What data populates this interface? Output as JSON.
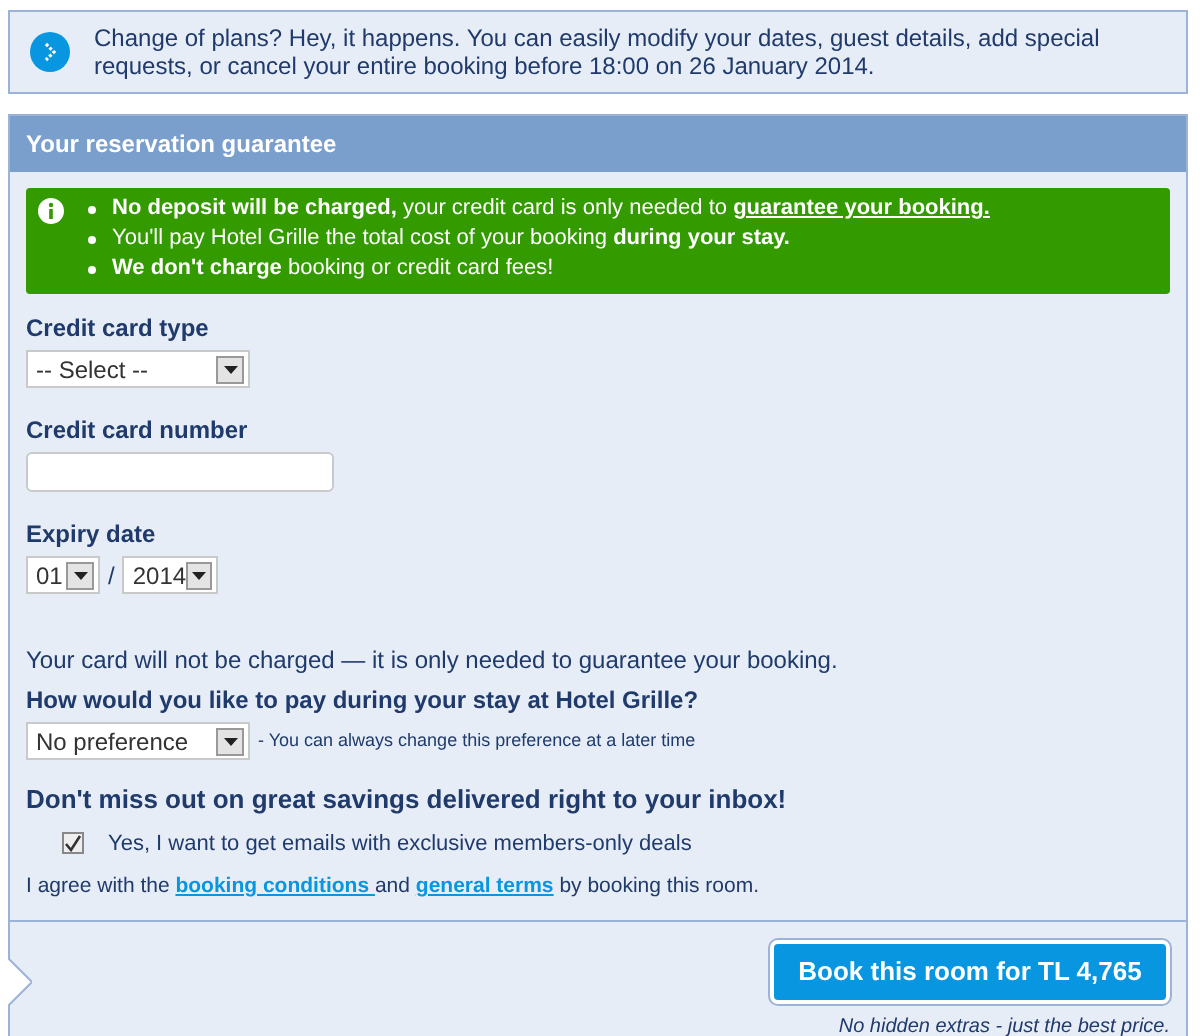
{
  "notice": {
    "text": "Change of plans? Hey, it happens. You can easily modify your dates, guest details, add special requests, or cancel your entire booking before 18:00 on 26 January 2014."
  },
  "guarantee": {
    "title": "Your reservation guarantee",
    "bullets": [
      [
        {
          "kind": "text",
          "text": "**No deposit will be charged,** your credit card is only needed to "
        },
        {
          "kind": "link",
          "text": "guarantee your booking."
        }
      ],
      [
        {
          "kind": "text",
          "text": "You'll pay Hotel Grille the total cost of your booking **during your stay.**"
        }
      ],
      [
        {
          "kind": "text",
          "text": "**We don't charge** booking or credit card fees!"
        }
      ]
    ]
  },
  "card_type": {
    "label": "Credit card type",
    "value": "-- Select --"
  },
  "card_number": {
    "label": "Credit card number"
  },
  "expiry": {
    "label": "Expiry date",
    "month": "01",
    "separator": "/",
    "year": "2014"
  },
  "not_charged": "Your card will not be charged — it is only needed to guarantee your booking.",
  "pay_question": "How would you like to pay during your stay at Hotel Grille?",
  "pay_select": {
    "value": "No preference",
    "hint": "- You can always change this preference at a later time"
  },
  "newsletter": {
    "title": "Don't miss out on great savings delivered right to your inbox!",
    "label": "Yes, I want to get emails with exclusive members-only deals",
    "checked": true
  },
  "agreement": [
    {
      "kind": "text",
      "text": "I agree with the "
    },
    {
      "kind": "link",
      "text": "booking conditions "
    },
    {
      "kind": "text",
      "text": "and "
    },
    {
      "kind": "link",
      "text": "general terms"
    },
    {
      "kind": "text",
      "text": " by booking this room."
    }
  ],
  "book_button": "Book this room for TL 4,765",
  "footnote": "No hidden extras - just the best price."
}
